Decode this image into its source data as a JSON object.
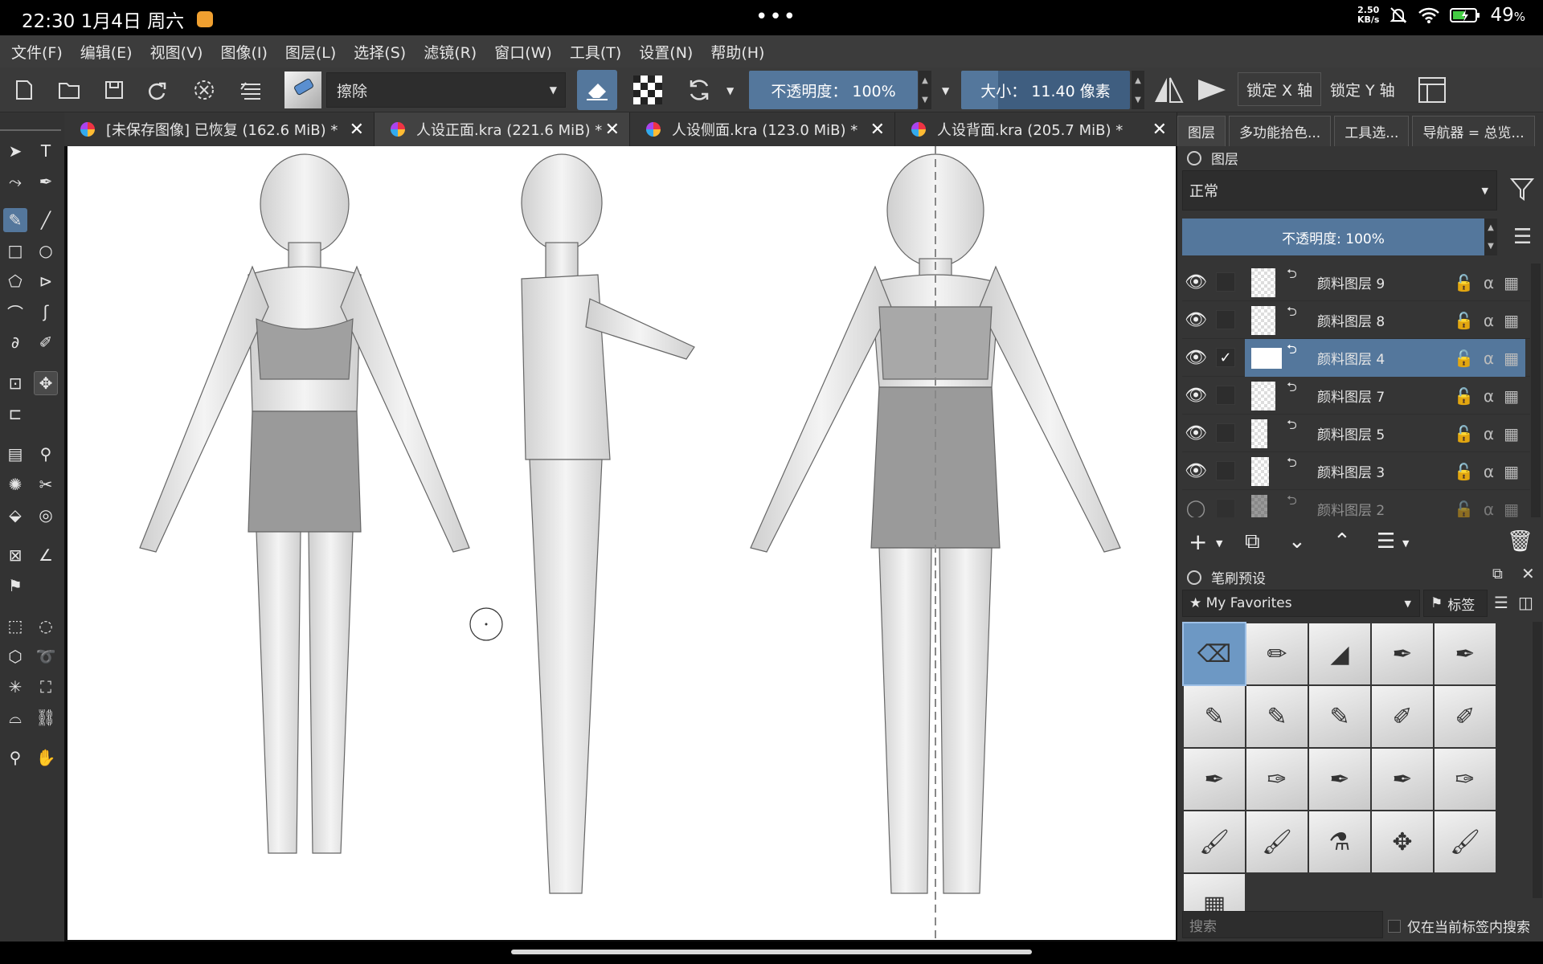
{
  "status_bar": {
    "time_date": "22:30  1月4日 周六",
    "center_dots": "•••",
    "net_speed_value": "2.50",
    "net_speed_unit": "KB/s",
    "battery": "49",
    "battery_unit": "%"
  },
  "menu": [
    "文件(F)",
    "编辑(E)",
    "视图(V)",
    "图像(I)",
    "图层(L)",
    "选择(S)",
    "滤镜(R)",
    "窗口(W)",
    "工具(T)",
    "设置(N)",
    "帮助(H)"
  ],
  "toolbar": {
    "blend_mode": "擦除",
    "opacity": "不透明度： 100%",
    "size": "大小： 11.40 像素",
    "lock_x": "锁定 X 轴",
    "lock_y": "锁定 Y 轴"
  },
  "tabs": [
    {
      "label": "[未保存图像] 已恢复 (162.6 MiB) *",
      "close": "✕"
    },
    {
      "label": "人设正面.kra (221.6 MiB) *",
      "close": "✕"
    },
    {
      "label": "人设侧面.kra (123.0 MiB) *",
      "close": "✕"
    },
    {
      "label": "人设背面.kra (205.7 MiB) *",
      "close": "✕"
    }
  ],
  "dock": {
    "tabs": [
      "图层",
      "多功能拾色...",
      "工具选...",
      "导航器 = 总览..."
    ],
    "layers_title": "图层",
    "blend_mode": "正常",
    "opacity": "不透明度: 100%",
    "layers": [
      {
        "name": "颜料图层 9",
        "checked": ""
      },
      {
        "name": "颜料图层 8",
        "checked": ""
      },
      {
        "name": "颜料图层 4",
        "checked": "✓"
      },
      {
        "name": "颜料图层 7",
        "checked": ""
      },
      {
        "name": "颜料图层 5",
        "checked": ""
      },
      {
        "name": "颜料图层 3",
        "checked": ""
      },
      {
        "name": "颜料图层 2",
        "checked": ""
      }
    ],
    "brush_title": "笔刷预设",
    "brush_tag": "★ My Favorites",
    "tag_button": "标签",
    "search_placeholder": "搜索",
    "search_option": "仅在当前标签内搜索"
  },
  "colors": {
    "accent": "#54779c",
    "panel_bg": "#353535",
    "menu_bg": "#3c3c3c"
  }
}
